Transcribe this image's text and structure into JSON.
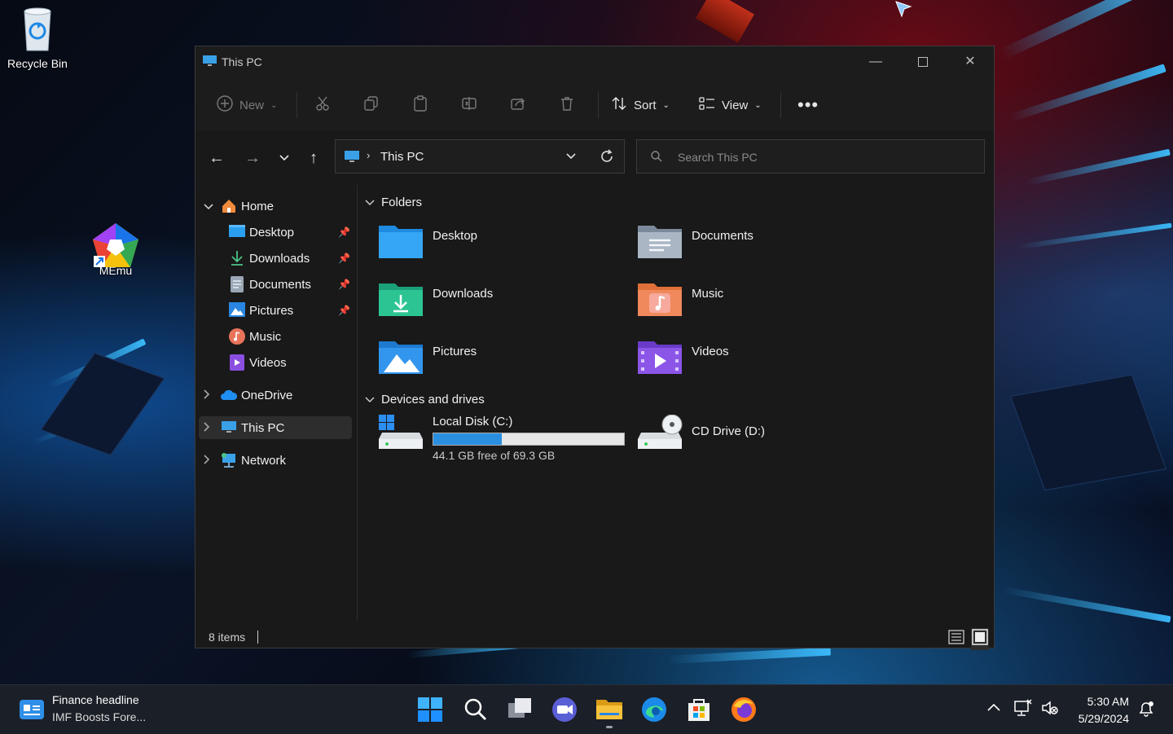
{
  "desktop": {
    "icons": [
      {
        "label": "Recycle Bin"
      },
      {
        "label": "MEmu"
      }
    ]
  },
  "window": {
    "title": "This PC",
    "toolbar": {
      "new_label": "New",
      "sort_label": "Sort",
      "view_label": "View"
    },
    "address": {
      "path": "This PC"
    },
    "search": {
      "placeholder": "Search This PC"
    },
    "sidebar": {
      "items": [
        {
          "label": "Home"
        },
        {
          "label": "Desktop"
        },
        {
          "label": "Downloads"
        },
        {
          "label": "Documents"
        },
        {
          "label": "Pictures"
        },
        {
          "label": "Music"
        },
        {
          "label": "Videos"
        },
        {
          "label": "OneDrive"
        },
        {
          "label": "This PC"
        },
        {
          "label": "Network"
        }
      ]
    },
    "content": {
      "folders_header": "Folders",
      "folders": [
        {
          "name": "Desktop"
        },
        {
          "name": "Documents"
        },
        {
          "name": "Downloads"
        },
        {
          "name": "Music"
        },
        {
          "name": "Pictures"
        },
        {
          "name": "Videos"
        }
      ],
      "devices_header": "Devices and drives",
      "drives": [
        {
          "name": "Local Disk (C:)",
          "free_text": "44.1 GB free of 69.3 GB",
          "used_fraction": 0.36
        },
        {
          "name": "CD Drive (D:)"
        }
      ]
    },
    "status": {
      "item_count": "8 items"
    }
  },
  "taskbar": {
    "widget": {
      "title": "Finance headline",
      "subtitle": "IMF Boosts Fore..."
    },
    "clock": {
      "time": "5:30 AM",
      "date": "5/29/2024"
    }
  },
  "colors": {
    "accent": "#3d9bff",
    "drive_bar": "#2a8fe0",
    "window_bg": "#191919"
  }
}
